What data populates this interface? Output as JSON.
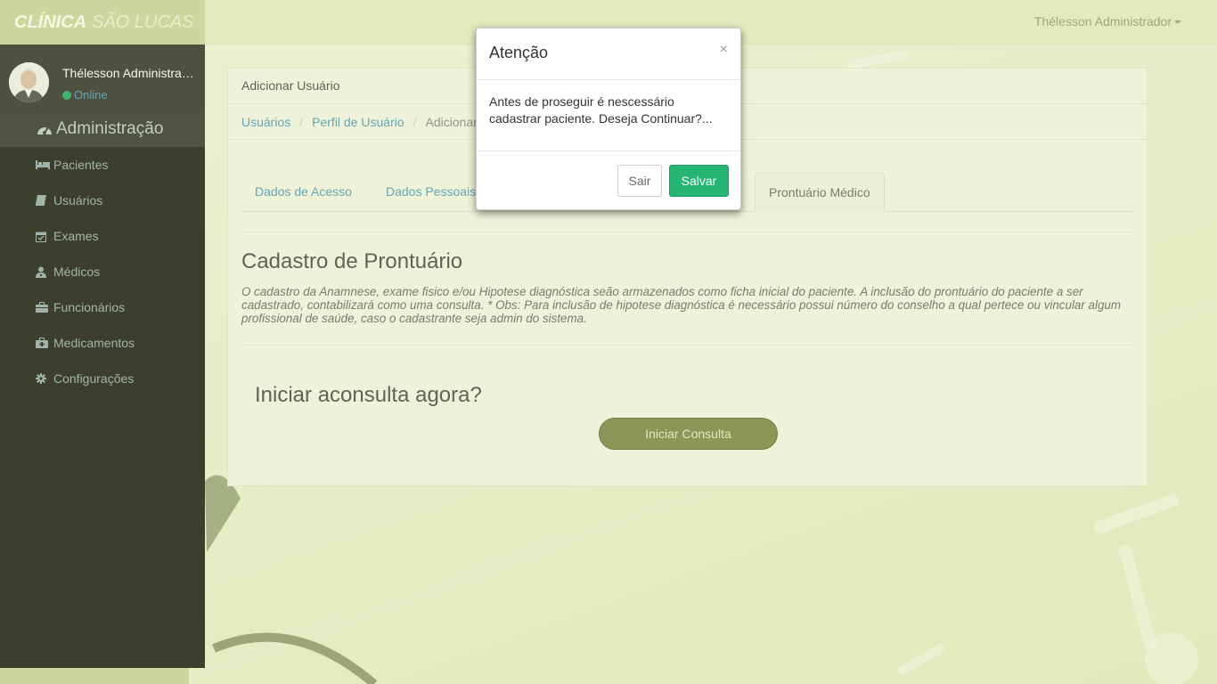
{
  "brand": {
    "part1": "CLÍNICA",
    "part2": "SÃO LUCAS"
  },
  "topbar": {
    "user_menu": "Thélesson Administrador"
  },
  "sidebar": {
    "profile_name": "Thélesson Administrador",
    "status": "Online",
    "header": {
      "label": "Administração",
      "icon": "dashboard-icon"
    },
    "items": [
      {
        "label": "Pacientes",
        "icon": "bed-icon"
      },
      {
        "label": "Usuários",
        "icon": "book-icon"
      },
      {
        "label": "Exames",
        "icon": "calendar-check-icon"
      },
      {
        "label": "Médicos",
        "icon": "user-md-icon"
      },
      {
        "label": "Funcionários",
        "icon": "briefcase-icon"
      },
      {
        "label": "Medicamentos",
        "icon": "medkit-icon"
      },
      {
        "label": "Configurações",
        "icon": "gear-icon"
      }
    ]
  },
  "panel": {
    "heading": "Adicionar Usuário",
    "breadcrumb": [
      "Usuários",
      "Perfil de Usuário",
      "Adicionar"
    ],
    "tabs": [
      "Dados de Acesso",
      "Dados Pessoais",
      "Prontuário Médico"
    ],
    "section_title": "Cadastro de Prontuário",
    "section_desc": "O cadastro da Anamnese, exame fisico e/ou Hipotese diagnóstica seão armazenados como ficha inicial do paciente. A inclusão do prontuário do paciente a ser cadastrado, contabilizará como uma consulta. * Obs: Para inclusão de hipotese diagnóstica é necessário possui número do conselho a qual pertece ou vincular algum profissional de saúde, caso o cadastrante seja admin do sistema.",
    "start_question": "Iniciar aconsulta agora?",
    "start_button": "Iniciar Consulta"
  },
  "modal": {
    "title": "Atenção",
    "close": "×",
    "body": "Antes de proseguir é nescessário cadastrar paciente. Deseja Continuar?...",
    "cancel_label": "Sair",
    "save_label": "Salvar"
  }
}
